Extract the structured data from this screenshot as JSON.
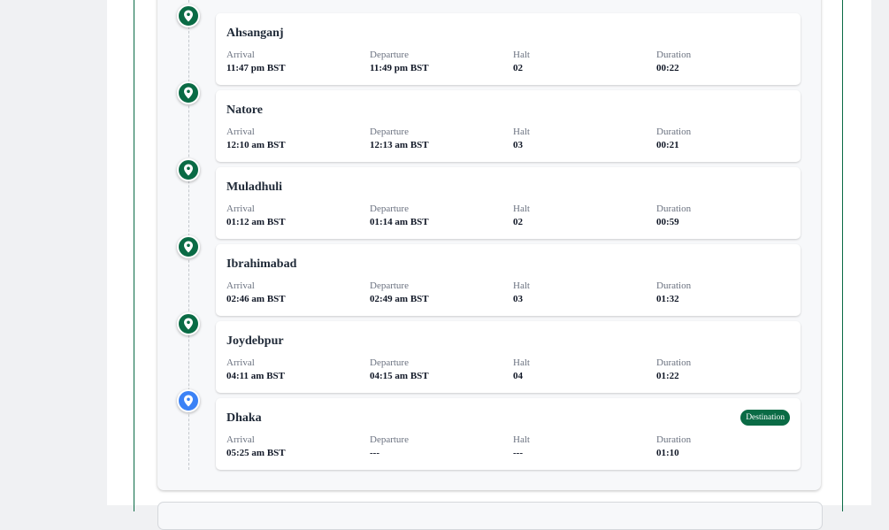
{
  "labels": {
    "arrival": "Arrival",
    "departure": "Departure",
    "halt": "Halt",
    "duration": "Duration"
  },
  "stops": [
    {
      "name": "Ahsanganj",
      "arrival": "11:47 pm BST",
      "departure": "11:49 pm BST",
      "halt": "02",
      "duration": "00:22",
      "marker": "green"
    },
    {
      "name": "Natore",
      "arrival": "12:10 am BST",
      "departure": "12:13 am BST",
      "halt": "03",
      "duration": "00:21",
      "marker": "green"
    },
    {
      "name": "Muladhuli",
      "arrival": "01:12 am BST",
      "departure": "01:14 am BST",
      "halt": "02",
      "duration": "00:59",
      "marker": "green"
    },
    {
      "name": "Ibrahimabad",
      "arrival": "02:46 am BST",
      "departure": "02:49 am BST",
      "halt": "03",
      "duration": "01:32",
      "marker": "green"
    },
    {
      "name": "Joydebpur",
      "arrival": "04:11 am BST",
      "departure": "04:15 am BST",
      "halt": "04",
      "duration": "01:22",
      "marker": "green"
    },
    {
      "name": "Dhaka",
      "arrival": "05:25 am BST",
      "departure": "---",
      "halt": "---",
      "duration": "01:10",
      "marker": "blue",
      "badge": "Destination"
    }
  ],
  "colors": {
    "accent_green": "#0a6b45",
    "destination_blue": "#3b82f6"
  },
  "icons": {
    "stop_marker": "map-pin-icon"
  }
}
